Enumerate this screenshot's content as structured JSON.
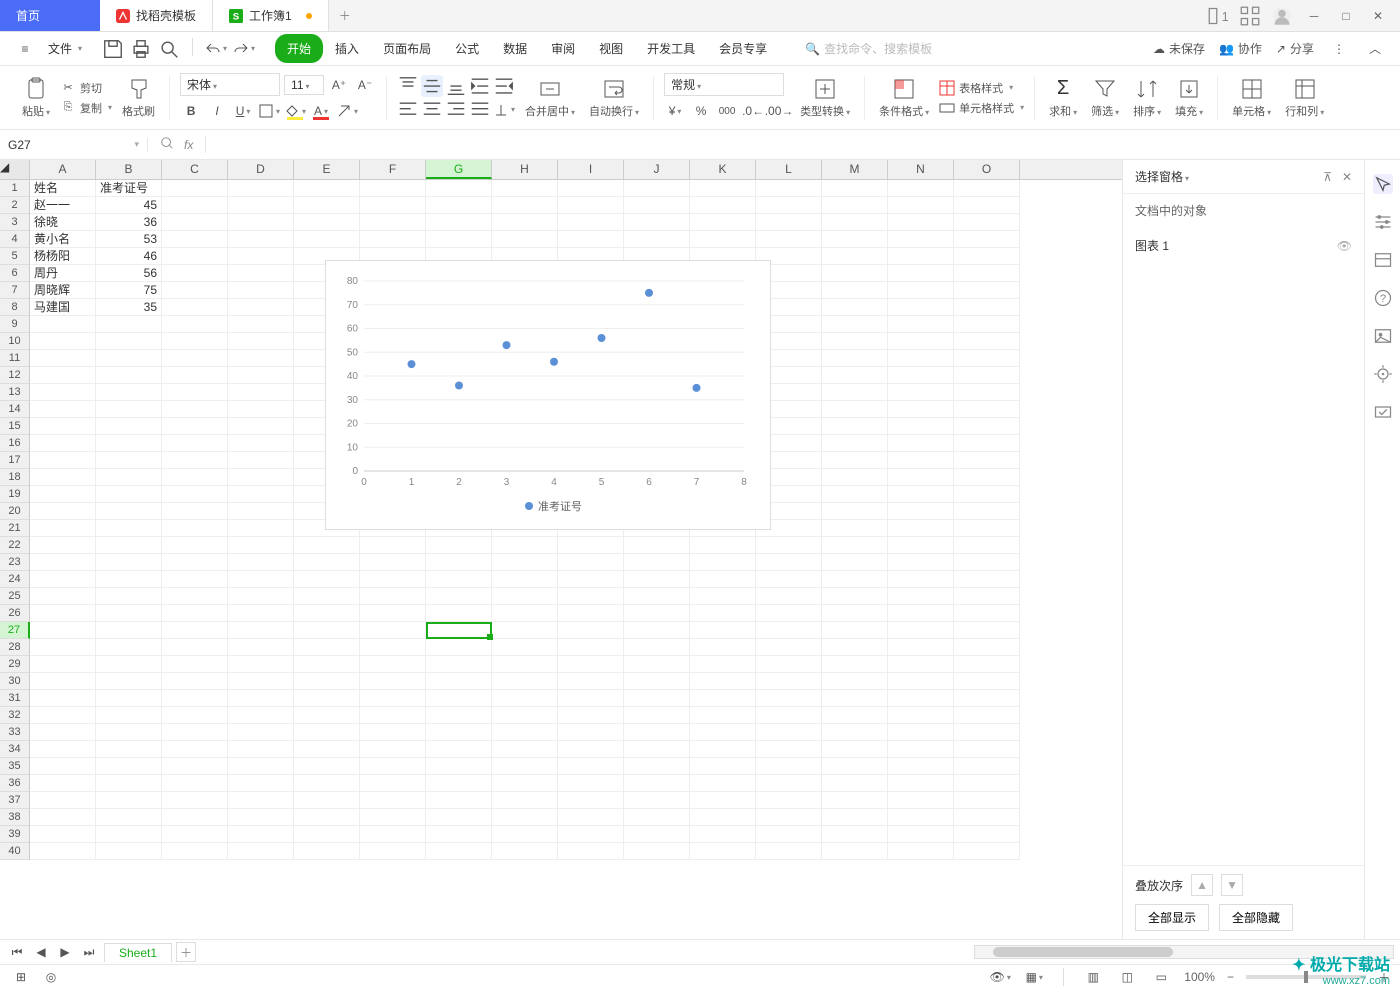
{
  "tabs": {
    "home": "首页",
    "templates": "找稻壳模板",
    "workbook": "工作簿1"
  },
  "menu": {
    "file": "文件",
    "ribbon": [
      "开始",
      "插入",
      "页面布局",
      "公式",
      "数据",
      "审阅",
      "视图",
      "开发工具",
      "会员专享"
    ],
    "search_placeholder": "查找命令、搜索模板",
    "unsaved": "未保存",
    "collab": "协作",
    "share": "分享"
  },
  "ribbon": {
    "paste": "粘贴",
    "cut": "剪切",
    "copy": "复制",
    "format_painter": "格式刷",
    "font_name": "宋体",
    "font_size": "11",
    "merge_center": "合并居中",
    "auto_wrap": "自动换行",
    "number_format": "常规",
    "type_convert": "类型转换",
    "cond_format": "条件格式",
    "table_style": "表格样式",
    "cell_style": "单元格样式",
    "sum": "求和",
    "filter": "筛选",
    "sort": "排序",
    "fill": "填充",
    "cell": "单元格",
    "row_col": "行和列"
  },
  "formula_bar": {
    "cell_ref": "G27"
  },
  "columns": [
    "A",
    "B",
    "C",
    "D",
    "E",
    "F",
    "G",
    "H",
    "I",
    "J",
    "K",
    "L",
    "M",
    "N",
    "O"
  ],
  "active_col": "G",
  "active_row": 27,
  "header_row": {
    "a": "姓名",
    "b": "准考证号"
  },
  "data_rows": [
    {
      "a": "赵一一",
      "b": "45"
    },
    {
      "a": "徐晓",
      "b": "36"
    },
    {
      "a": "黄小名",
      "b": "53"
    },
    {
      "a": "杨杨阳",
      "b": "46"
    },
    {
      "a": "周丹",
      "b": "56"
    },
    {
      "a": "周晓辉",
      "b": "75"
    },
    {
      "a": "马建国",
      "b": "35"
    }
  ],
  "chart_data": {
    "type": "scatter",
    "legend": "准考证号",
    "x": [
      1,
      2,
      3,
      4,
      5,
      6,
      7
    ],
    "y": [
      45,
      36,
      53,
      46,
      56,
      75,
      35
    ],
    "xlim": [
      0,
      8
    ],
    "ylim": [
      0,
      80
    ],
    "xticks": [
      0,
      1,
      2,
      3,
      4,
      5,
      6,
      7,
      8
    ],
    "yticks": [
      0,
      10,
      20,
      30,
      40,
      50,
      60,
      70,
      80
    ]
  },
  "selection_pane": {
    "title": "选择窗格",
    "subtitle": "文档中的对象",
    "items": [
      "图表 1"
    ],
    "stack_label": "叠放次序",
    "show_all": "全部显示",
    "hide_all": "全部隐藏"
  },
  "sheet": {
    "name": "Sheet1"
  },
  "status": {
    "zoom": "100%"
  },
  "watermark": {
    "line1": "极光下载站",
    "line2": "www.xz7.com"
  }
}
